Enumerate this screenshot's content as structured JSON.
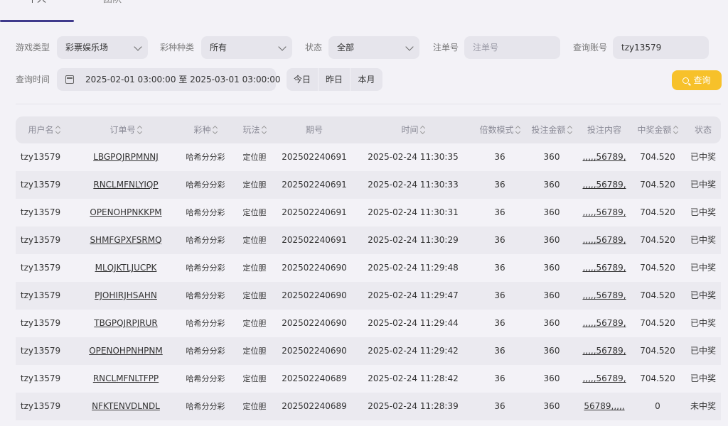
{
  "tabs": [
    {
      "label": "个人"
    },
    {
      "label": "团队"
    }
  ],
  "filters": {
    "game_type_label": "游戏类型",
    "game_type_value": "彩票娱乐场",
    "lottery_label": "彩种种类",
    "lottery_value": "所有",
    "status_label": "状态",
    "status_value": "全部",
    "order_label": "注单号",
    "order_placeholder": "注单号",
    "account_label": "查询账号",
    "account_value": "tzy13579",
    "time_label": "查询时间",
    "time_value": "2025-02-01 03:00:00 至 2025-03-01 03:00:00",
    "today": "今日",
    "yesterday": "昨日",
    "month": "本月",
    "query": "查询"
  },
  "table": {
    "headers": [
      "用户名",
      "订单号",
      "彩种",
      "玩法",
      "期号",
      "时间",
      "倍数模式",
      "投注金额",
      "投注内容",
      "中奖金额",
      "状态"
    ],
    "rows": [
      [
        "tzy13579",
        "LBGPQJRPMNNJ",
        "哈希分分彩",
        "定位胆",
        "202502240691",
        "2025-02-24 11:30:35",
        "36",
        "360",
        ",,,,,56789,",
        "704.520",
        "已中奖"
      ],
      [
        "tzy13579",
        "RNCLMFNLYIQP",
        "哈希分分彩",
        "定位胆",
        "202502240691",
        "2025-02-24 11:30:33",
        "36",
        "360",
        ",,,,,56789,",
        "704.520",
        "已中奖"
      ],
      [
        "tzy13579",
        "OPENOHPNKKPM",
        "哈希分分彩",
        "定位胆",
        "202502240691",
        "2025-02-24 11:30:31",
        "36",
        "360",
        ",,,,,56789,",
        "704.520",
        "已中奖"
      ],
      [
        "tzy13579",
        "SHMFGPXFSRMQ",
        "哈希分分彩",
        "定位胆",
        "202502240691",
        "2025-02-24 11:30:29",
        "36",
        "360",
        ",,,,,56789,",
        "704.520",
        "已中奖"
      ],
      [
        "tzy13579",
        "MLQJKTLJUCPK",
        "哈希分分彩",
        "定位胆",
        "202502240690",
        "2025-02-24 11:29:48",
        "36",
        "360",
        ",,,,,56789,",
        "704.520",
        "已中奖"
      ],
      [
        "tzy13579",
        "PJOHIRJHSAHN",
        "哈希分分彩",
        "定位胆",
        "202502240690",
        "2025-02-24 11:29:47",
        "36",
        "360",
        ",,,,,56789,",
        "704.520",
        "已中奖"
      ],
      [
        "tzy13579",
        "TBGPQJRPJRUR",
        "哈希分分彩",
        "定位胆",
        "202502240690",
        "2025-02-24 11:29:44",
        "36",
        "360",
        ",,,,,56789,",
        "704.520",
        "已中奖"
      ],
      [
        "tzy13579",
        "OPENOHPNHPNM",
        "哈希分分彩",
        "定位胆",
        "202502240690",
        "2025-02-24 11:29:42",
        "36",
        "360",
        ",,,,,56789,",
        "704.520",
        "已中奖"
      ],
      [
        "tzy13579",
        "RNCLMFNLTFPP",
        "哈希分分彩",
        "定位胆",
        "202502240689",
        "2025-02-24 11:28:42",
        "36",
        "360",
        ",,,,,56789,",
        "704.520",
        "已中奖"
      ],
      [
        "tzy13579",
        "NFKTENVDLNDL",
        "哈希分分彩",
        "定位胆",
        "202502240689",
        "2025-02-24 11:28:39",
        "36",
        "360",
        "56789,,,,,",
        "0",
        "未中奖"
      ]
    ]
  }
}
